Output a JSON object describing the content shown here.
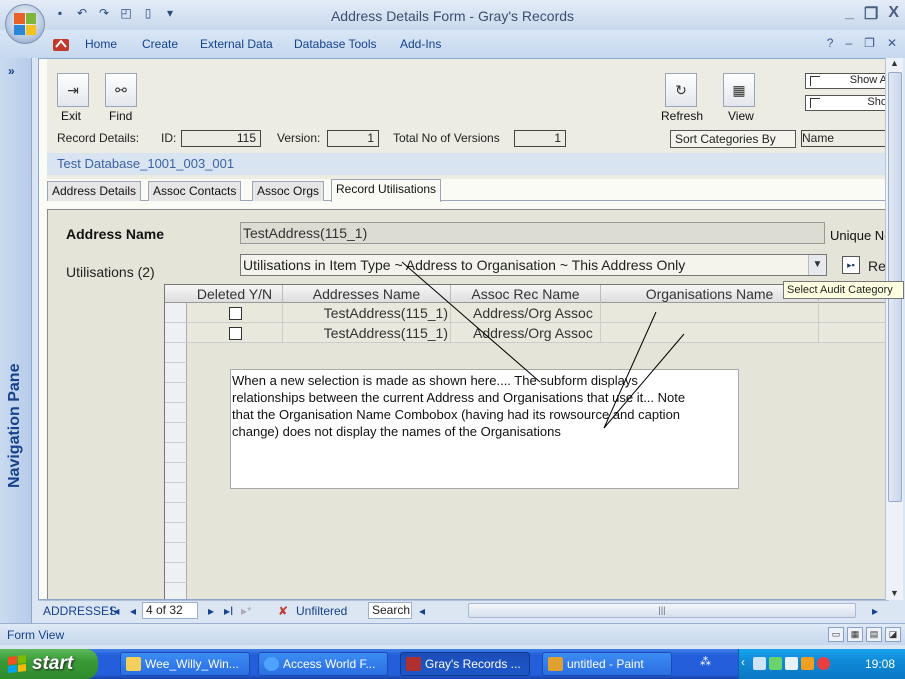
{
  "window": {
    "title": "Address Details Form - Gray's Records",
    "controls": [
      "_",
      "❐",
      "X"
    ]
  },
  "ribbon": {
    "tabs": [
      "Home",
      "Create",
      "External Data",
      "Database Tools",
      "Add-Ins"
    ],
    "right_controls": [
      "?",
      "–",
      "❐",
      "✕"
    ]
  },
  "nav_pane": {
    "expand": "»",
    "label": "Navigation Pane"
  },
  "form_header": {
    "exit_label": "Exit",
    "find_label": "Find",
    "refresh_label": "Refresh",
    "view_label": "View",
    "show_a": "Show A",
    "show_b": "Sho"
  },
  "record_details": {
    "label": "Record Details:",
    "id_label": "ID:",
    "id_value": "115",
    "version_label": "Version:",
    "version_value": "1",
    "total_label": "Total No of Versions",
    "total_value": "1",
    "sort_button": "Sort Categories By",
    "sort_value": "Name"
  },
  "database_name": "Test Database_1001_003_001",
  "form_tabs": [
    "Address Details",
    "Assoc Contacts",
    "Assoc Orgs",
    "Record Utilisations"
  ],
  "tab_page": {
    "address_label": "Address Name",
    "address_value": "TestAddress(115_1)",
    "unique_label": "Unique No",
    "utilisations_label": "Utilisations (2)",
    "utilisations_value": "Utilisations in Item Type ~ Address to Organisation ~ This Address Only",
    "ret_label": "Ret"
  },
  "datasheet": {
    "columns": [
      "Deleted Y/N",
      "Addresses Name",
      "Assoc Rec Name",
      "Organisations Name"
    ],
    "rows": [
      {
        "deleted": false,
        "address": "TestAddress(115_1)",
        "assoc": "Address/Org Assoc",
        "org": ""
      },
      {
        "deleted": false,
        "address": "TestAddress(115_1)",
        "assoc": "Address/Org Assoc",
        "org": ""
      }
    ]
  },
  "tooltip": "Select Audit Category",
  "annotation": {
    "line1": "When a new selection is made as shown here....   The subform displays",
    "line2": "relationships between the current Address and Organisations that use it... Note",
    "line3": "that the Organisation Name Combobox (having had its rowsource and caption",
    "line4": "change) does not display the names of the Organisations"
  },
  "record_nav": {
    "label": "ADDRESSES",
    "first": "I◂",
    "prev": "◂",
    "position": "4 of 32",
    "next": "▸",
    "last": "▸I",
    "new": "▸*",
    "filter": "Unfiltered",
    "search": "Search"
  },
  "status_bar": {
    "text": "Form View"
  },
  "taskbar": {
    "start": "start",
    "tasks": [
      "Wee_Willy_Win...",
      "Access World F...",
      "Gray's Records ...",
      "untitled - Paint"
    ],
    "clock": "19:08"
  },
  "colors": {
    "ribbon_text": "#15428b",
    "taskbar_blue": "#245edb",
    "start_green": "#3a9b38",
    "tray_blue": "#0f8ad7"
  }
}
